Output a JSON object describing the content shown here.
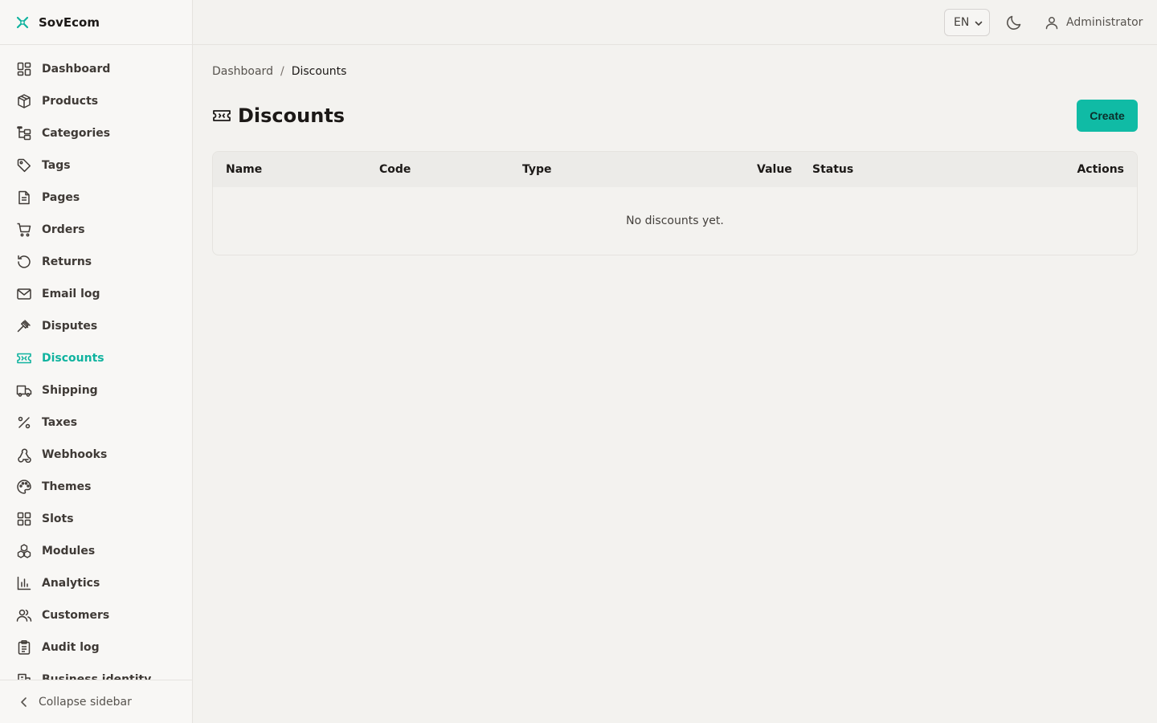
{
  "app": {
    "name": "SovEcom"
  },
  "sidebar": {
    "items": [
      {
        "label": "Dashboard",
        "icon": "dashboard-icon"
      },
      {
        "label": "Products",
        "icon": "box-icon"
      },
      {
        "label": "Categories",
        "icon": "tree-icon"
      },
      {
        "label": "Tags",
        "icon": "tag-icon"
      },
      {
        "label": "Pages",
        "icon": "file-icon"
      },
      {
        "label": "Orders",
        "icon": "cart-icon"
      },
      {
        "label": "Returns",
        "icon": "rotate-icon"
      },
      {
        "label": "Email log",
        "icon": "mail-icon"
      },
      {
        "label": "Disputes",
        "icon": "gavel-icon"
      },
      {
        "label": "Discounts",
        "icon": "ticket-icon"
      },
      {
        "label": "Shipping",
        "icon": "truck-icon"
      },
      {
        "label": "Taxes",
        "icon": "percent-icon"
      },
      {
        "label": "Webhooks",
        "icon": "webhook-icon"
      },
      {
        "label": "Themes",
        "icon": "palette-icon"
      },
      {
        "label": "Slots",
        "icon": "grid-icon"
      },
      {
        "label": "Modules",
        "icon": "boxes-icon"
      },
      {
        "label": "Analytics",
        "icon": "bar-chart-icon"
      },
      {
        "label": "Customers",
        "icon": "users-icon"
      },
      {
        "label": "Audit log",
        "icon": "clipboard-icon"
      },
      {
        "label": "Business identity",
        "icon": "building-icon"
      }
    ],
    "active": "Discounts",
    "collapse_label": "Collapse sidebar"
  },
  "topbar": {
    "language": "EN",
    "user_label": "Administrator"
  },
  "breadcrumb": {
    "home": "Dashboard",
    "separator": "/",
    "current": "Discounts"
  },
  "page": {
    "title": "Discounts",
    "create_label": "Create"
  },
  "table": {
    "columns": [
      "Name",
      "Code",
      "Type",
      "Value",
      "Status",
      "Actions"
    ],
    "empty_message": "No discounts yet."
  },
  "colors": {
    "accent": "#10bba5",
    "active_nav": "#10b39f"
  }
}
